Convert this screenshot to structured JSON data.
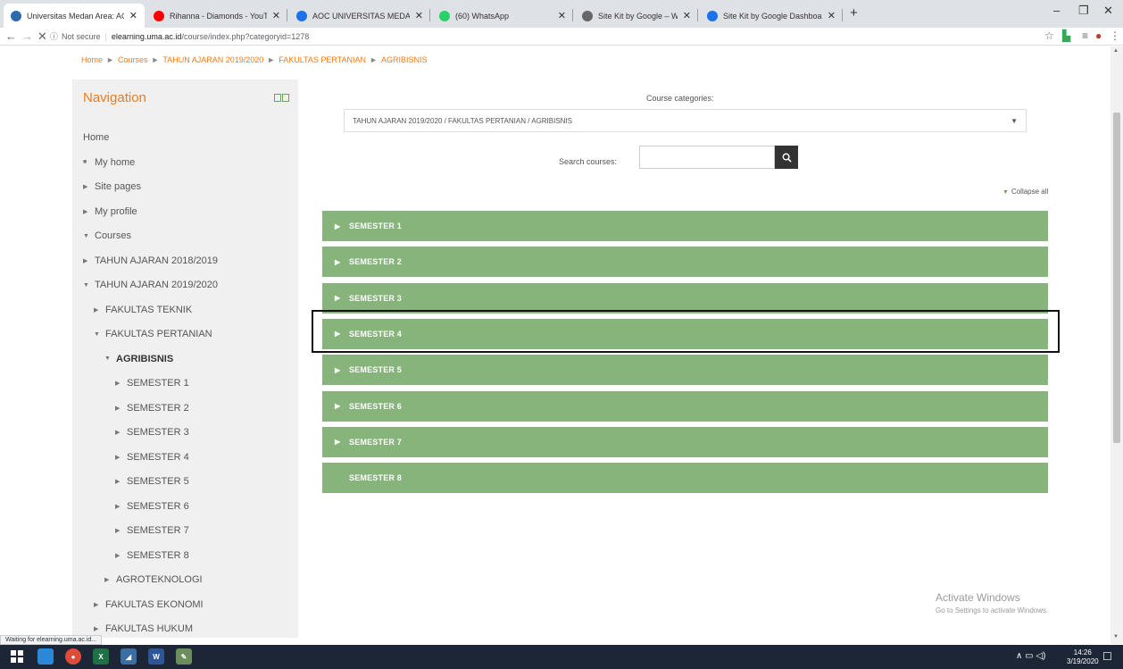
{
  "browser": {
    "tabs": [
      {
        "title": "Universitas Medan Area: AGRIBIS",
        "icon": "uma-favicon-icon",
        "color": "#2b6cb0",
        "active": true
      },
      {
        "title": "Rihanna - Diamonds - YouTu",
        "icon": "youtube-icon",
        "color": "#ff0000",
        "active": false
      },
      {
        "title": "AOC UNIVERSITAS MEDAN AREA",
        "icon": "globe-icon",
        "color": "#1a73e8",
        "active": false
      },
      {
        "title": "(60) WhatsApp",
        "icon": "whatsapp-icon",
        "color": "#25d366",
        "active": false
      },
      {
        "title": "Site Kit by Google – WordPress p",
        "icon": "wordpress-icon",
        "color": "#666666",
        "active": false
      },
      {
        "title": "Site Kit by Google Dashboard ‹ A",
        "icon": "globe-icon",
        "color": "#1a73e8",
        "active": false
      }
    ],
    "new_tab": "+",
    "address": {
      "security": "Not secure",
      "host": "elearning.uma.ac.id",
      "path": "/course/index.php?categoryid=1278"
    },
    "status_text": "Waiting for elearning.uma.ac.id..."
  },
  "breadcrumb": [
    "Home",
    "Courses",
    "TAHUN AJARAN 2019/2020",
    "FAKULTAS PERTANIAN",
    "AGRIBISNIS"
  ],
  "navigation": {
    "title": "Navigation",
    "items": [
      {
        "label": "Home",
        "marker": "",
        "level": 0
      },
      {
        "label": "My home",
        "marker": "■",
        "level": 0
      },
      {
        "label": "Site pages",
        "marker": "▶",
        "level": 0
      },
      {
        "label": "My profile",
        "marker": "▶",
        "level": 0
      },
      {
        "label": "Courses",
        "marker": "▼",
        "level": 0
      },
      {
        "label": "TAHUN AJARAN 2018/2019",
        "marker": "▶",
        "level": 1
      },
      {
        "label": "TAHUN AJARAN 2019/2020",
        "marker": "▼",
        "level": 1
      },
      {
        "label": "FAKULTAS TEKNIK",
        "marker": "▶",
        "level": 2
      },
      {
        "label": "FAKULTAS PERTANIAN",
        "marker": "▼",
        "level": 2
      },
      {
        "label": "AGRIBISNIS",
        "marker": "▼",
        "level": 3,
        "bold": true
      },
      {
        "label": "SEMESTER 1",
        "marker": "▶",
        "level": 4
      },
      {
        "label": "SEMESTER 2",
        "marker": "▶",
        "level": 4
      },
      {
        "label": "SEMESTER 3",
        "marker": "▶",
        "level": 4
      },
      {
        "label": "SEMESTER 4",
        "marker": "▶",
        "level": 4
      },
      {
        "label": "SEMESTER 5",
        "marker": "▶",
        "level": 4
      },
      {
        "label": "SEMESTER 6",
        "marker": "▶",
        "level": 4
      },
      {
        "label": "SEMESTER 7",
        "marker": "▶",
        "level": 4
      },
      {
        "label": "SEMESTER 8",
        "marker": "▶",
        "level": 4
      },
      {
        "label": "AGROTEKNOLOGI",
        "marker": "▶",
        "level": 3
      },
      {
        "label": "FAKULTAS EKONOMI",
        "marker": "▶",
        "level": 2
      },
      {
        "label": "FAKULTAS HUKUM",
        "marker": "▶",
        "level": 2
      }
    ]
  },
  "course_categories": {
    "label": "Course categories:",
    "selected": "TAHUN AJARAN 2019/2020 / FAKULTAS PERTANIAN / AGRIBISNIS"
  },
  "search": {
    "label": "Search courses:",
    "value": ""
  },
  "collapse_all": "Collapse all",
  "semesters": [
    {
      "label": "SEMESTER 1",
      "expandable": true
    },
    {
      "label": "SEMESTER 2",
      "expandable": true
    },
    {
      "label": "SEMESTER 3",
      "expandable": true
    },
    {
      "label": "SEMESTER 4",
      "expandable": true,
      "highlighted": true
    },
    {
      "label": "SEMESTER 5",
      "expandable": true
    },
    {
      "label": "SEMESTER 6",
      "expandable": true
    },
    {
      "label": "SEMESTER 7",
      "expandable": true
    },
    {
      "label": "SEMESTER 8",
      "expandable": false
    }
  ],
  "watermark": {
    "title": "Activate Windows",
    "subtitle": "Go to Settings to activate Windows."
  },
  "taskbar": {
    "time": "14:26",
    "date": "3/19/2020"
  },
  "colors": {
    "accent": "#f07b1e",
    "semester_bar": "#86b47b",
    "nav_bg": "#f0f0f0"
  }
}
